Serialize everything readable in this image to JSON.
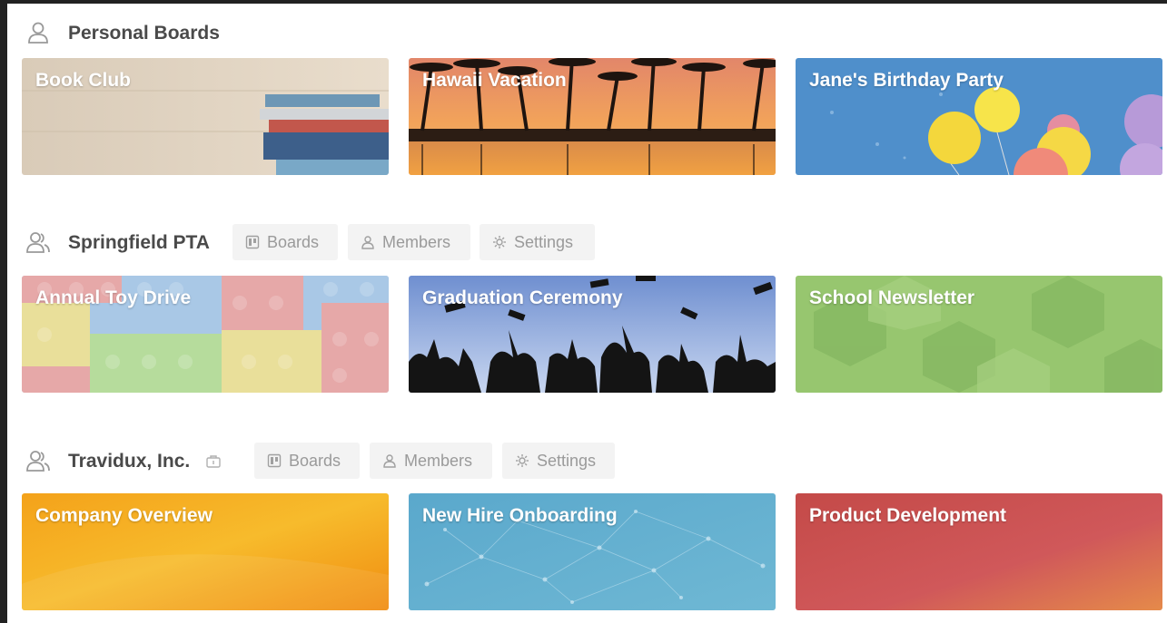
{
  "sections": [
    {
      "title": "Personal Boards",
      "icon": "person-icon",
      "boards": [
        {
          "title": "Book Club",
          "theme": "books"
        },
        {
          "title": "Hawaii Vacation",
          "theme": "sunset-palms"
        },
        {
          "title": "Jane's Birthday Party",
          "theme": "balloons"
        }
      ]
    },
    {
      "title": "Springfield PTA",
      "icon": "team-icon",
      "tabs": {
        "boards": "Boards",
        "members": "Members",
        "settings": "Settings"
      },
      "boards": [
        {
          "title": "Annual Toy Drive",
          "theme": "toy-bricks"
        },
        {
          "title": "Graduation Ceremony",
          "theme": "graduates"
        },
        {
          "title": "School Newsletter",
          "theme": "green-hexagons"
        }
      ]
    },
    {
      "title": "Travidux, Inc.",
      "icon": "team-icon",
      "badge_icon": "briefcase-icon",
      "tabs": {
        "boards": "Boards",
        "members": "Members",
        "settings": "Settings"
      },
      "boards": [
        {
          "title": "Company Overview",
          "theme": "orange-gradient"
        },
        {
          "title": "New Hire Onboarding",
          "theme": "blue-network"
        },
        {
          "title": "Product Development",
          "theme": "red-gradient"
        }
      ]
    }
  ],
  "colors": {
    "page_bg": "#ffffff",
    "heading": "#4a4a4a",
    "tab_bg": "#f3f3f3",
    "tab_text": "#9a9a9a"
  }
}
